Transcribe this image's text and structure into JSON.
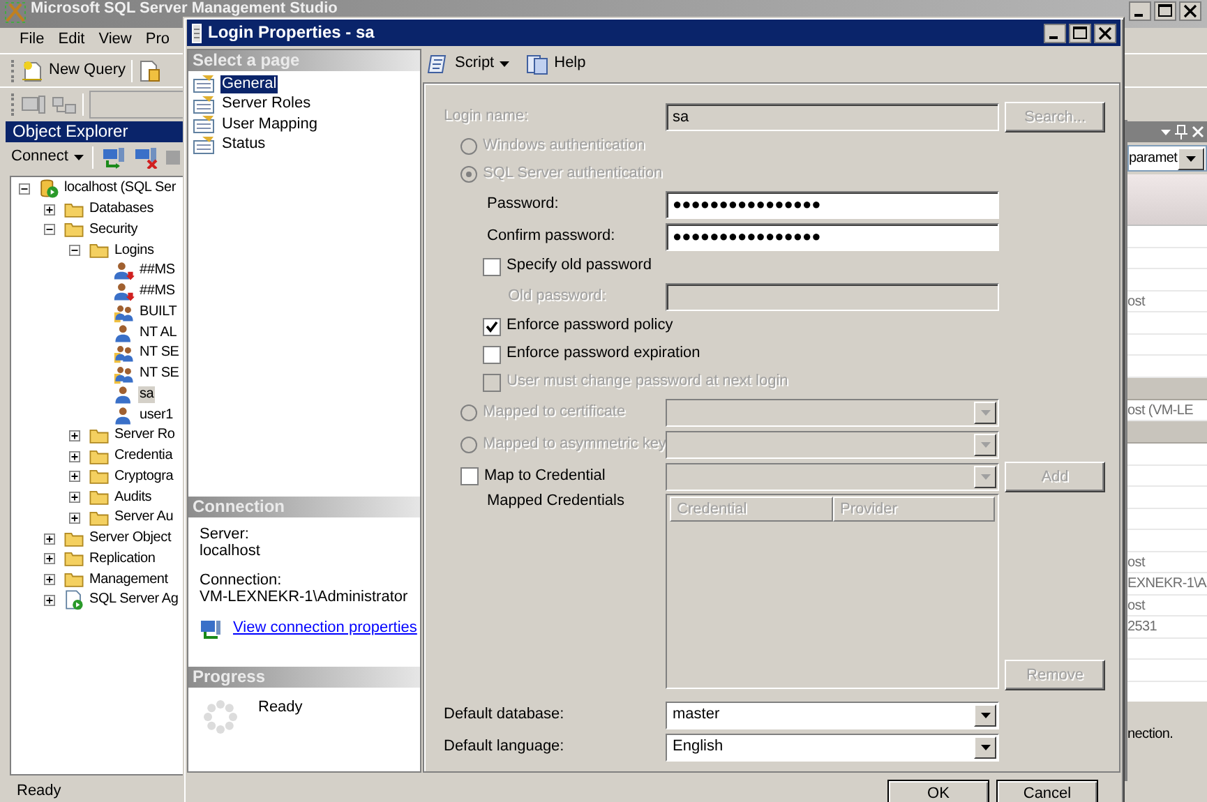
{
  "main_window": {
    "title": "Microsoft SQL Server Management Studio",
    "menu": [
      {
        "label": "File"
      },
      {
        "label": "Edit"
      },
      {
        "label": "View"
      },
      {
        "label": "Pro"
      }
    ],
    "toolbar": [
      {
        "label": "New Query"
      }
    ],
    "object_explorer": {
      "title": "Object Explorer",
      "connect_label": "Connect",
      "tree": [
        {
          "label": "localhost (SQL Ser",
          "kind": "server",
          "expanded": true,
          "selected": false,
          "children": [
            {
              "label": "Databases",
              "kind": "folder",
              "expanded": false,
              "selected": false
            },
            {
              "label": "Security",
              "kind": "folder",
              "expanded": true,
              "selected": false,
              "children": [
                {
                  "label": "Logins",
                  "kind": "folder",
                  "expanded": true,
                  "selected": false,
                  "children": [
                    {
                      "label": "##MS",
                      "kind": "login_disabled",
                      "selected": false
                    },
                    {
                      "label": "##MS",
                      "kind": "login_disabled",
                      "selected": false
                    },
                    {
                      "label": "BUILT",
                      "kind": "login_group",
                      "selected": false
                    },
                    {
                      "label": "NT AL",
                      "kind": "login",
                      "selected": false
                    },
                    {
                      "label": "NT SE",
                      "kind": "login_group",
                      "selected": false
                    },
                    {
                      "label": "NT SE",
                      "kind": "login_group",
                      "selected": false
                    },
                    {
                      "label": "sa",
                      "kind": "login",
                      "selected": true
                    },
                    {
                      "label": "user1",
                      "kind": "login",
                      "selected": false
                    }
                  ]
                },
                {
                  "label": "Server Ro",
                  "kind": "folder",
                  "expanded": false,
                  "selected": false
                },
                {
                  "label": "Credentia",
                  "kind": "folder",
                  "expanded": false,
                  "selected": false
                },
                {
                  "label": "Cryptogra",
                  "kind": "folder",
                  "expanded": false,
                  "selected": false
                },
                {
                  "label": "Audits",
                  "kind": "folder",
                  "expanded": false,
                  "selected": false
                },
                {
                  "label": "Server Au",
                  "kind": "folder",
                  "expanded": false,
                  "selected": false
                }
              ]
            },
            {
              "label": "Server Object",
              "kind": "folder",
              "expanded": false,
              "selected": false
            },
            {
              "label": "Replication",
              "kind": "folder",
              "expanded": false,
              "selected": false
            },
            {
              "label": "Management",
              "kind": "folder",
              "expanded": false,
              "selected": false
            },
            {
              "label": "SQL Server Ag",
              "kind": "agent",
              "expanded": false,
              "selected": false
            }
          ]
        }
      ]
    },
    "properties_panel": {
      "filter": "paramet",
      "rows": [
        {
          "kind": "property"
        },
        {
          "kind": "property"
        },
        {
          "kind": "property"
        },
        {
          "kind": "property",
          "value": "ost"
        },
        {
          "kind": "property"
        },
        {
          "kind": "property"
        },
        {
          "kind": "property"
        },
        {
          "kind": "category"
        },
        {
          "kind": "property",
          "value": "ost (VM-LE"
        },
        {
          "kind": "category"
        },
        {
          "kind": "property"
        },
        {
          "kind": "property"
        },
        {
          "kind": "property"
        },
        {
          "kind": "property"
        },
        {
          "kind": "property"
        },
        {
          "kind": "property",
          "value": "ost"
        },
        {
          "kind": "property",
          "value": "EXNEKR-1\\A"
        },
        {
          "kind": "property",
          "value": "ost"
        },
        {
          "kind": "property",
          "value": "2531"
        },
        {
          "kind": "property"
        },
        {
          "kind": "property"
        }
      ],
      "description": "nection."
    },
    "status_bar": "Ready"
  },
  "dialog": {
    "title": "Login Properties - sa",
    "select_page": {
      "title": "Select a page",
      "pages": [
        {
          "label": "General",
          "selected": true
        },
        {
          "label": "Server Roles",
          "selected": false
        },
        {
          "label": "User Mapping",
          "selected": false
        },
        {
          "label": "Status",
          "selected": false
        }
      ]
    },
    "connection": {
      "title": "Connection",
      "server_label": "Server:",
      "server": "localhost",
      "connection_label": "Connection:",
      "connection": "VM-LEXNEKR-1\\Administrator",
      "link": "View connection properties"
    },
    "progress": {
      "title": "Progress",
      "status": "Ready"
    },
    "toolbar": [
      {
        "label": "Script",
        "kind": "dropdown"
      },
      {
        "label": "Help",
        "kind": "button"
      }
    ],
    "form": [
      {
        "kind": "text",
        "label": "Login name:",
        "value": "sa",
        "disabled": true,
        "button": {
          "label": "Search...",
          "disabled": true
        }
      },
      {
        "kind": "radio",
        "label": "Windows authentication",
        "selected": false,
        "disabled": true
      },
      {
        "kind": "radio",
        "label": "SQL Server authentication",
        "selected": true,
        "disabled": true,
        "children": [
          {
            "kind": "password",
            "label": "Password:",
            "value": "●●●●●●●●●●●●●●●●",
            "disabled": false
          },
          {
            "kind": "password",
            "label": "Confirm password:",
            "value": "●●●●●●●●●●●●●●●●",
            "disabled": false
          },
          {
            "kind": "checkbox",
            "label": "Specify old password",
            "checked": false,
            "disabled": false,
            "children": [
              {
                "kind": "password",
                "label": "Old password:",
                "disabled": true
              }
            ]
          },
          {
            "kind": "checkbox",
            "label": "Enforce password policy",
            "checked": true,
            "disabled": false
          },
          {
            "kind": "checkbox",
            "label": "Enforce password expiration",
            "checked": false,
            "disabled": false
          },
          {
            "kind": "checkbox",
            "label": "User must change password at next login",
            "checked": false,
            "disabled": true
          }
        ]
      },
      {
        "kind": "radio",
        "label": "Mapped to certificate",
        "selected": false,
        "disabled": true,
        "dropdown": {
          "disabled": true
        }
      },
      {
        "kind": "radio",
        "label": "Mapped to asymmetric key",
        "selected": false,
        "disabled": true,
        "dropdown": {
          "disabled": true
        }
      },
      {
        "kind": "checkbox",
        "label": "Map to Credential",
        "checked": false,
        "disabled": false,
        "dropdown": {
          "disabled": true
        },
        "button": {
          "label": "Add",
          "disabled": true
        },
        "children": [
          {
            "kind": "table",
            "label": "Mapped Credentials",
            "columns": [
              "Credential",
              "Provider"
            ],
            "disabled": true,
            "button": {
              "label": "Remove",
              "disabled": true
            }
          }
        ]
      },
      {
        "kind": "dropdown",
        "label": "Default database:",
        "value": "master",
        "disabled": false
      },
      {
        "kind": "dropdown",
        "label": "Default language:",
        "value": "English",
        "disabled": false
      }
    ],
    "buttons": [
      {
        "label": "OK"
      },
      {
        "label": "Cancel"
      }
    ]
  }
}
